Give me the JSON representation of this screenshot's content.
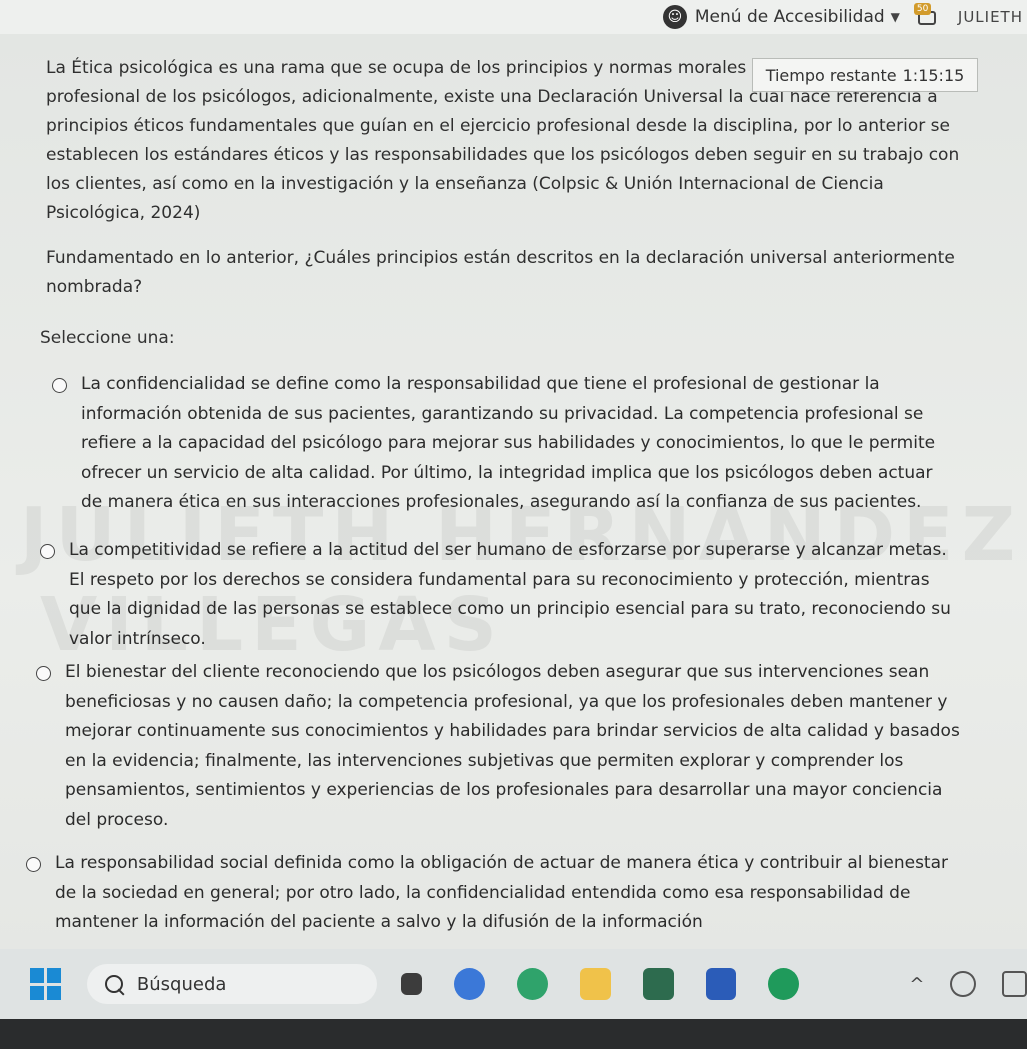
{
  "topbar": {
    "accessibility_menu": "Menú de Accesibilidad",
    "notification_count": "50",
    "user_name": "JULIETH"
  },
  "timer": {
    "label": "Tiempo restante",
    "value": "1:15:15"
  },
  "question": {
    "paragraph1": "La Ética psicológica es una rama que se ocupa de los principios y normas morales de la práctica profesional de los psicólogos, adicionalmente, existe una Declaración Universal la cual hace referencia a principios éticos fundamentales que guían en el ejercicio profesional desde la disciplina, por lo anterior se establecen los estándares éticos y las responsabilidades que los psicólogos deben seguir en su trabajo con los clientes, así como en la investigación y la enseñanza (Colpsic & Unión Internacional de Ciencia Psicológica, 2024)",
    "paragraph2": "Fundamentado en lo anterior, ¿Cuáles principios están descritos en la declaración universal anteriormente nombrada?"
  },
  "select_label": "Seleccione una:",
  "options": [
    {
      "text": "La confidencialidad se define como la responsabilidad que tiene el profesional de gestionar la información obtenida de sus pacientes, garantizando su privacidad. La competencia profesional se refiere a la capacidad del psicólogo para mejorar sus habilidades y conocimientos, lo que le permite ofrecer un servicio de alta calidad. Por último, la integridad implica que los psicólogos deben actuar de manera ética en sus interacciones profesionales, asegurando así la confianza de sus pacientes."
    },
    {
      "text": "La competitividad se refiere a la actitud del ser humano de esforzarse por superarse y alcanzar metas. El respeto por los derechos se considera fundamental para su reconocimiento y protección, mientras que la dignidad de las personas se establece como un principio esencial para su trato, reconociendo su valor intrínseco."
    },
    {
      "text": "El bienestar del cliente reconociendo que los psicólogos deben asegurar que sus intervenciones sean beneficiosas y no causen daño; la competencia profesional, ya que los profesionales deben mantener y mejorar continuamente sus conocimientos y habilidades para brindar servicios de alta calidad y basados en la evidencia; finalmente, las intervenciones subjetivas que permiten explorar y comprender los pensamientos, sentimientos y experiencias de los profesionales para desarrollar una mayor conciencia del proceso."
    },
    {
      "text": "La responsabilidad social definida como la obligación de actuar de manera ética y contribuir al bienestar de la sociedad en general; por otro lado, la confidencialidad entendida como esa responsabilidad de mantener la información del paciente a salvo y la difusión de la información"
    }
  ],
  "watermark": {
    "line1": "JULIETH HERNANDEZ",
    "line2": "VILLEGAS"
  },
  "taskbar": {
    "search_label": "Búsqueda"
  },
  "colors": {
    "accent": "#1a8ad4",
    "badge": "#d29b2b"
  }
}
